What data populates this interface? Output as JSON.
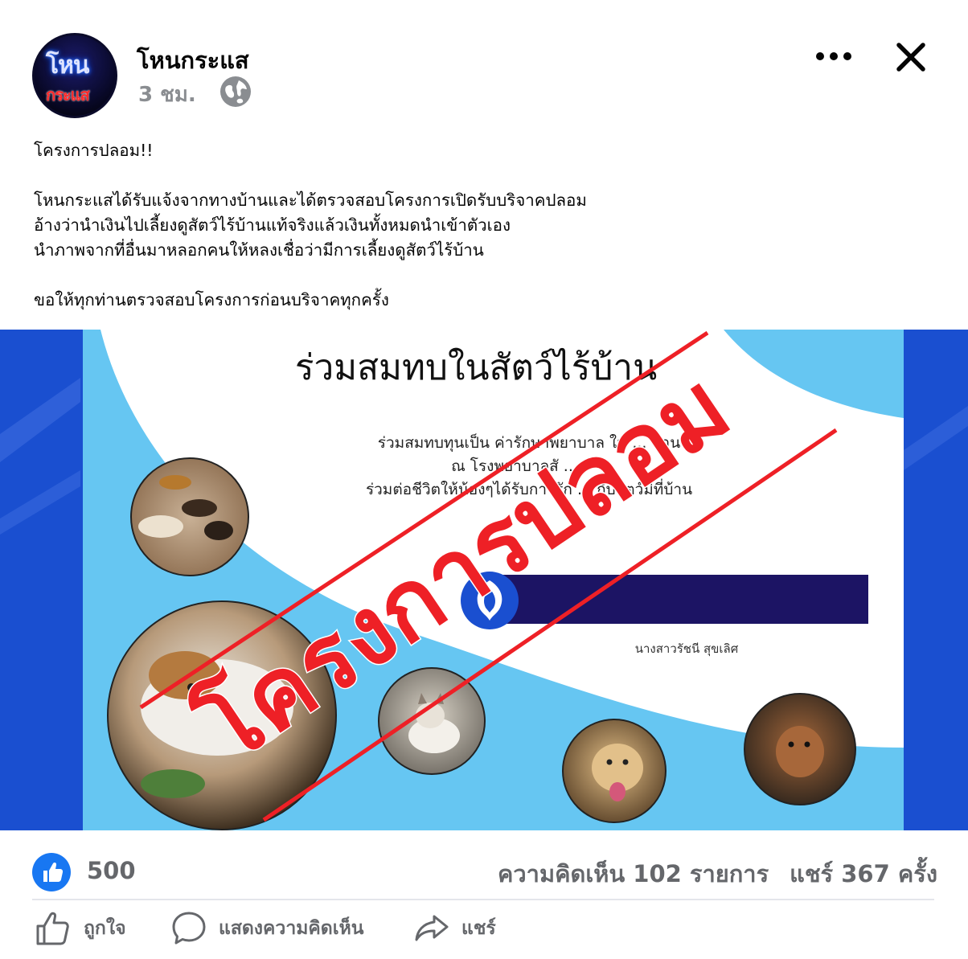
{
  "post": {
    "page_name": "โหนกระแส",
    "time": "3 ชม.",
    "avatar": {
      "line1": "โหน",
      "line2": "กระแส"
    },
    "icons": {
      "privacy": "globe-icon",
      "more": "more-horizontal-icon",
      "close": "close-icon"
    },
    "text": {
      "headline": "โครงการปลอม!!",
      "paragraph_lines": [
        "โหนกระแสได้รับแจ้งจากทางบ้านและได้ตรวจสอบโครงการเปิดรับบริจาคปลอม",
        "อ้างว่านำเงินไปเลี้ยงดูสัตว์ไร้บ้านแท้จริงแล้วเงินทั้งหมดนำเข้าตัวเอง",
        "นำภาพจากที่อื่นมาหลอกคนให้หลงเชื่อว่ามีการเลี้ยงดูสัตว์ไร้บ้าน"
      ],
      "closing": "ขอให้ทุกท่านตรวจสอบโครงการก่อนบริจาคทุกครั้ง"
    }
  },
  "image": {
    "title": "ร่วมสมทบในสัตว์ไร้บ้าน",
    "lines": [
      "ร่วมสมทบทุนเป็น ค่ารักษาพยาบาล ใน ... บ้าน",
      "ณ โรงพยาบาลสั ...",
      "ร่วมต่อชีวิตให้น้องๆได้รับการรัก ... กับสัตว์มีที่บ้าน"
    ],
    "account_name": "นางสาวรัชนี สุขเลิศ",
    "stamp": "โครงการปลอม",
    "colors": {
      "frame": "#1a4fd0",
      "panel": "#66c6f2",
      "account_bar": "#1c1464",
      "stamp": "#ee2026"
    }
  },
  "stats": {
    "likes": "500",
    "comments": "ความคิดเห็น 102 รายการ",
    "shares": "แชร์ 367 ครั้ง",
    "like_icon": "thumbs-up-icon"
  },
  "actions": [
    {
      "label": "ถูกใจ",
      "icon": "thumbs-up-outline-icon"
    },
    {
      "label": "แสดงความคิดเห็น",
      "icon": "comment-icon"
    },
    {
      "label": "แชร์",
      "icon": "share-icon"
    }
  ]
}
